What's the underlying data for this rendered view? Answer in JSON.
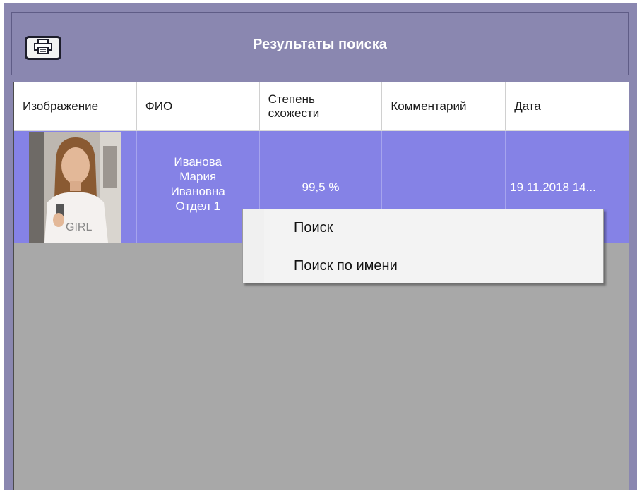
{
  "header": {
    "title": "Результаты поиска",
    "print_icon": "printer-icon"
  },
  "table": {
    "columns": [
      "Изображение",
      "ФИО",
      "Степень\nсхожести",
      "Комментарий",
      "Дата"
    ],
    "rows": [
      {
        "fio_lines": [
          "Иванова",
          "Мария",
          "Ивановна",
          "Отдел 1"
        ],
        "similarity": "99,5 %",
        "comment": "",
        "date": "19.11.2018 14..."
      }
    ]
  },
  "context_menu": {
    "items": [
      "Поиск",
      "Поиск по имени"
    ]
  },
  "colors": {
    "window": "#8a87b0",
    "row_selected": "#8582e6",
    "grid_background": "#a8a8a8"
  }
}
